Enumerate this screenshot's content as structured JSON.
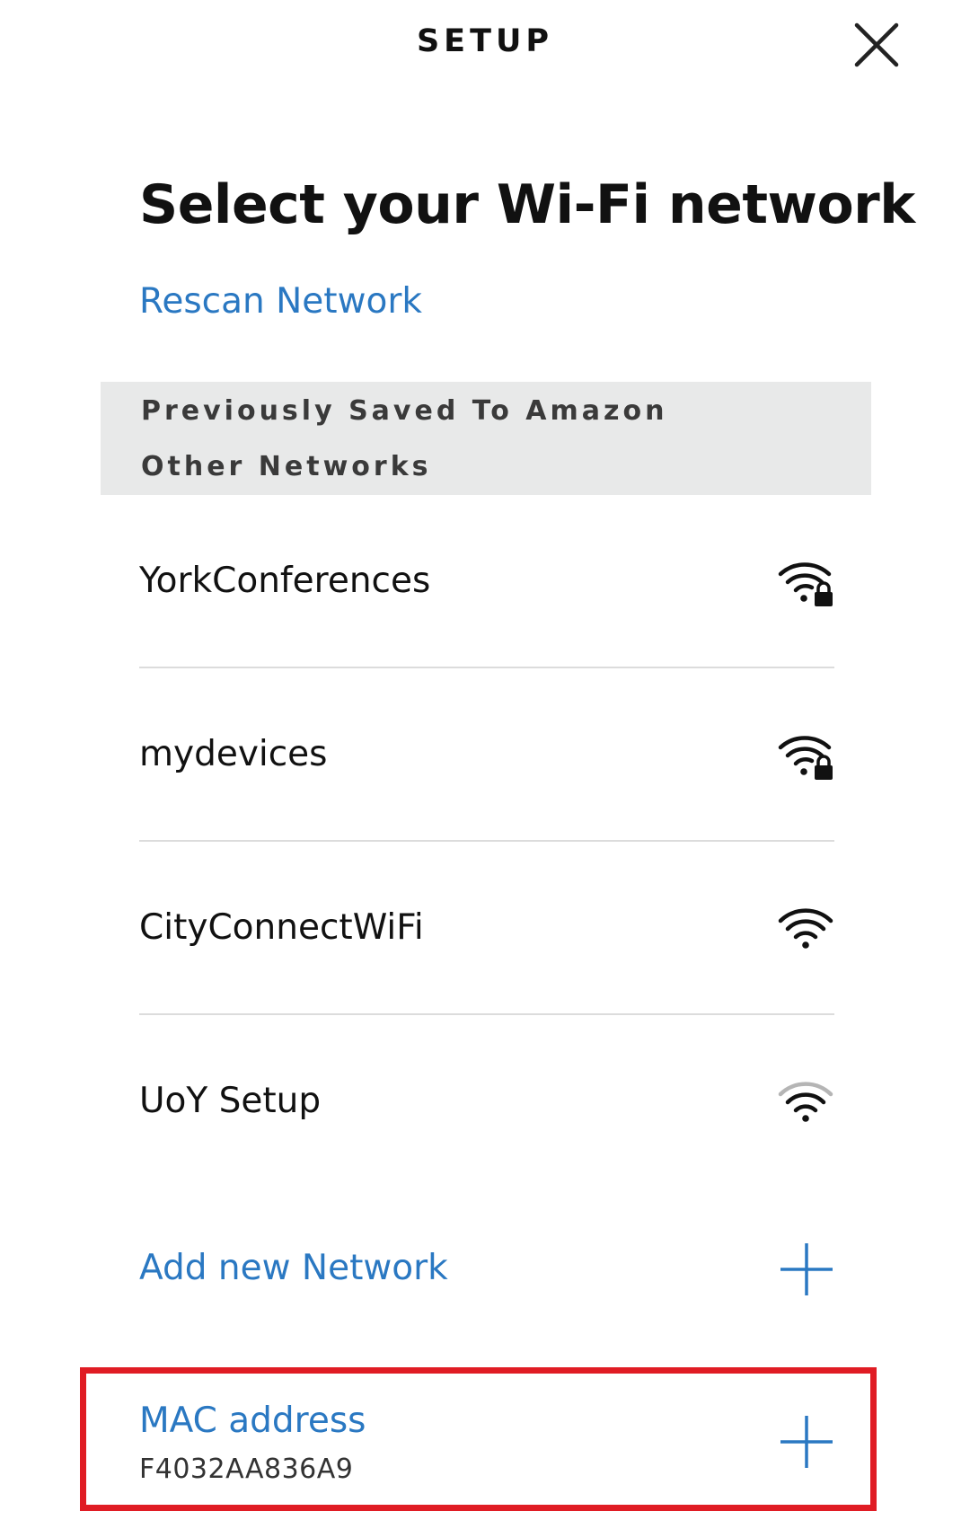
{
  "header": {
    "title": "SETUP",
    "close_icon": "close-icon"
  },
  "page": {
    "title": "Select your Wi-Fi network",
    "rescan_label": "Rescan Network"
  },
  "saved_panel": {
    "heading_saved": "Previously Saved To Amazon",
    "heading_other": "Other Networks"
  },
  "networks": [
    {
      "name": "YorkConferences",
      "icon": "wifi-lock-icon",
      "secured": true
    },
    {
      "name": "mydevices",
      "icon": "wifi-lock-icon",
      "secured": true
    },
    {
      "name": "CityConnectWiFi",
      "icon": "wifi-icon",
      "secured": false
    },
    {
      "name": "UoY Setup",
      "icon": "wifi-weak-icon",
      "secured": false
    }
  ],
  "add_network": {
    "label": "Add new Network",
    "icon": "plus-icon"
  },
  "mac": {
    "label": "MAC address",
    "value": "F4032AA836A9",
    "icon": "plus-icon",
    "highlight_color": "#e01c24"
  },
  "colors": {
    "link": "#2a78c2",
    "panel_bg": "#e8e9e9",
    "text": "#111111"
  }
}
